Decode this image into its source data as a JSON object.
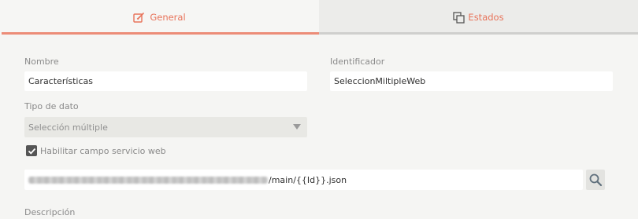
{
  "tabs": [
    {
      "label": "General",
      "icon": "edit-icon",
      "active": true
    },
    {
      "label": "Estados",
      "icon": "copy-icon",
      "active": false
    }
  ],
  "form": {
    "nombre": {
      "label": "Nombre",
      "value": "Características"
    },
    "identificador": {
      "label": "Identificador",
      "value": "SeleccionMiltipleWeb"
    },
    "tipo_dato": {
      "label": "Tipo de dato",
      "value": "Selección múltiple"
    },
    "servicio_web": {
      "label": "Habilitar campo servicio web",
      "checked": true
    },
    "url": {
      "visible_suffix": "/main/{{Id}}.json",
      "prefix_blurred": true
    },
    "descripcion": {
      "label": "Descripción"
    }
  },
  "colors": {
    "accent": "#e8735a",
    "tab_underline": "#ec8c77",
    "background": "#f5f5f3"
  }
}
